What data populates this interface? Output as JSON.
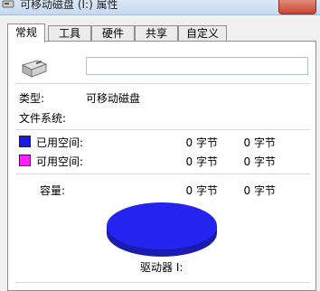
{
  "window": {
    "title": "可移动磁盘 (I:) 属性"
  },
  "tabs": [
    {
      "label": "常规",
      "active": true
    },
    {
      "label": "工具",
      "active": false
    },
    {
      "label": "硬件",
      "active": false
    },
    {
      "label": "共享",
      "active": false
    },
    {
      "label": "自定义",
      "active": false
    }
  ],
  "general": {
    "name_value": "",
    "type_label": "类型:",
    "type_value": "可移动磁盘",
    "fs_label": "文件系统:",
    "fs_value": "",
    "used": {
      "label": "已用空间:",
      "bytes": "0 字节",
      "size": "0 字节",
      "color": "#1a1ae6"
    },
    "free": {
      "label": "可用空间:",
      "bytes": "0 字节",
      "size": "0 字节",
      "color": "#ff22ff"
    },
    "capacity": {
      "label": "容量:",
      "bytes": "0 字节",
      "size": "0 字节"
    },
    "pie_color": "#2424f0",
    "drive_label": "驱动器 I:"
  },
  "icons": {
    "title": "removable-drive-icon",
    "drive": "removable-drive-icon"
  }
}
